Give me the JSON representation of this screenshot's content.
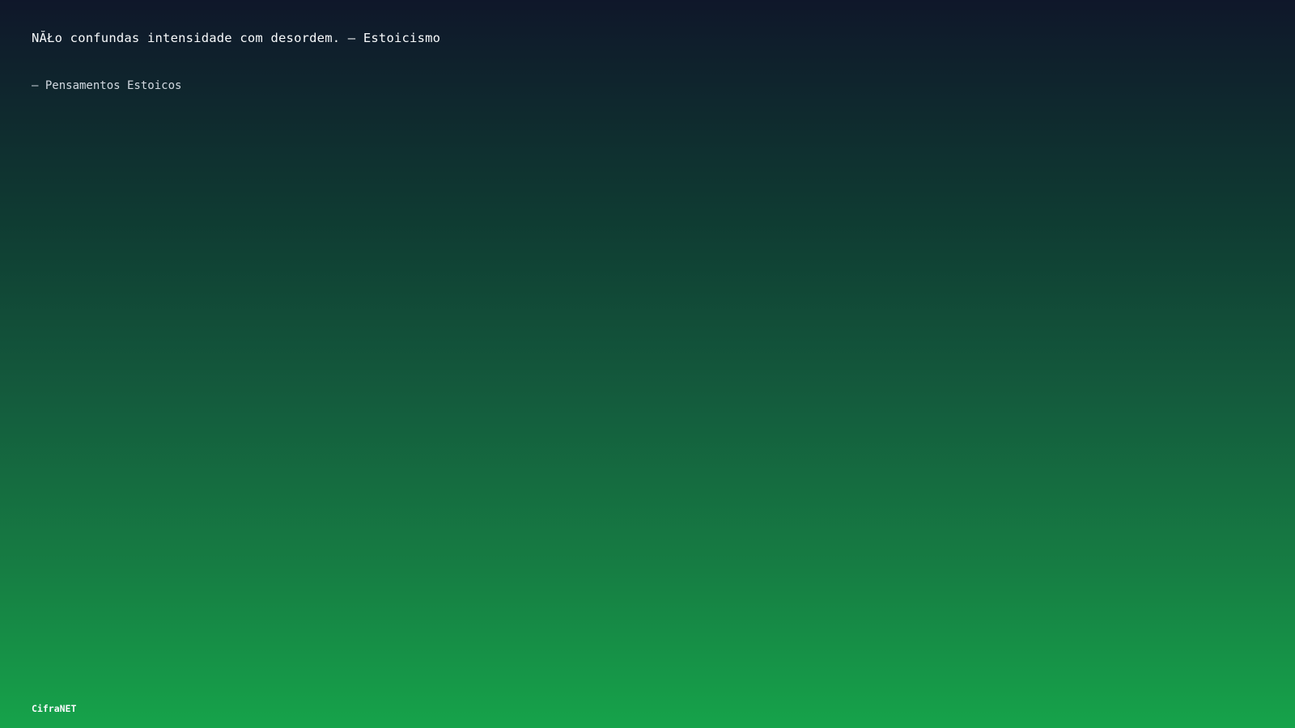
{
  "screen": {
    "quote": "NĂŁo confundas intensidade com desordem. — Estoicismo",
    "source": "— Pensamentos Estoicos",
    "brand": "CifraNET"
  },
  "colors": {
    "gradient_top": "#0f172a",
    "gradient_bottom": "#16a34a",
    "text": "#ffffff"
  }
}
